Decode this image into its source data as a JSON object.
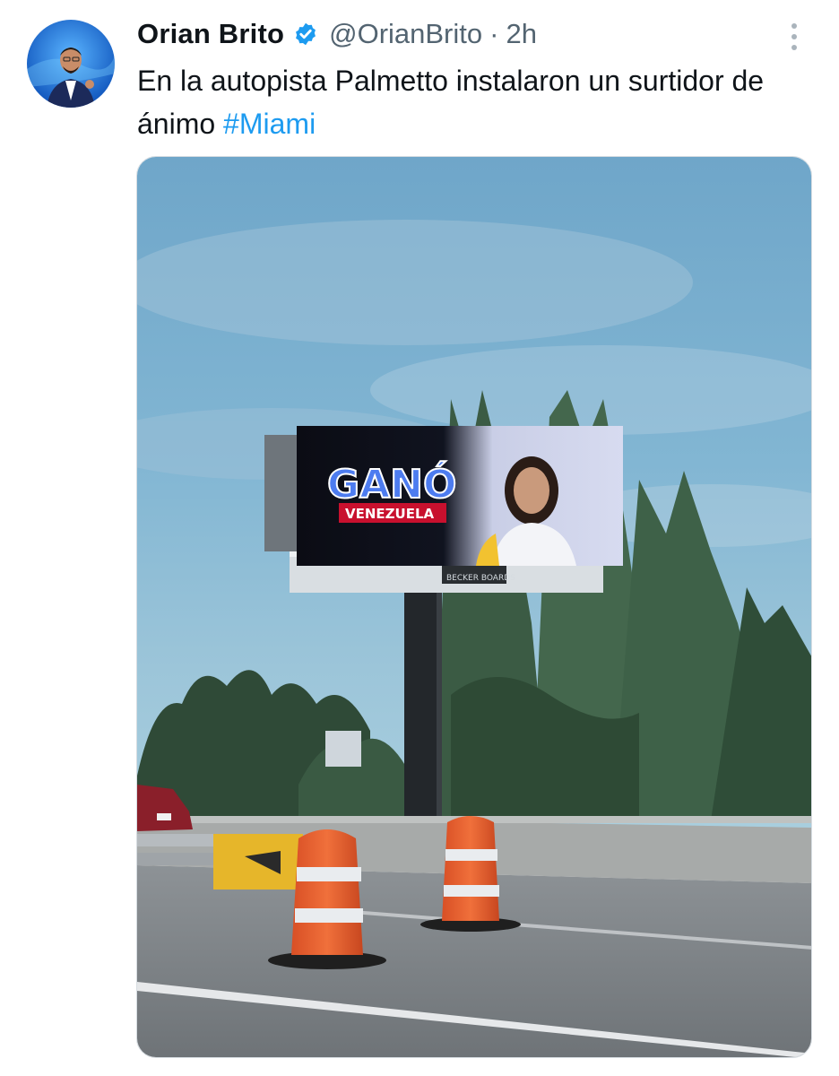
{
  "tweet": {
    "author": {
      "display_name": "Orian Brito",
      "handle": "@OrianBrito",
      "verified": true,
      "avatar_icon": "profile-photo"
    },
    "separator": "·",
    "timestamp": "2h",
    "text_main": "En la autopista Palmetto instalaron un surtidor de ánimo ",
    "hashtag": "#Miami",
    "more_icon": "vertical-ellipsis-icon",
    "media": {
      "kind": "photo",
      "billboard_headline": "GANÓ",
      "billboard_subline": "VENEZUELA",
      "billboard_brand": "BECKER BOARDS"
    }
  },
  "colors": {
    "text": "#0f1419",
    "muted": "#536471",
    "link": "#1d9bf0",
    "verified": "#1d9bf0"
  }
}
